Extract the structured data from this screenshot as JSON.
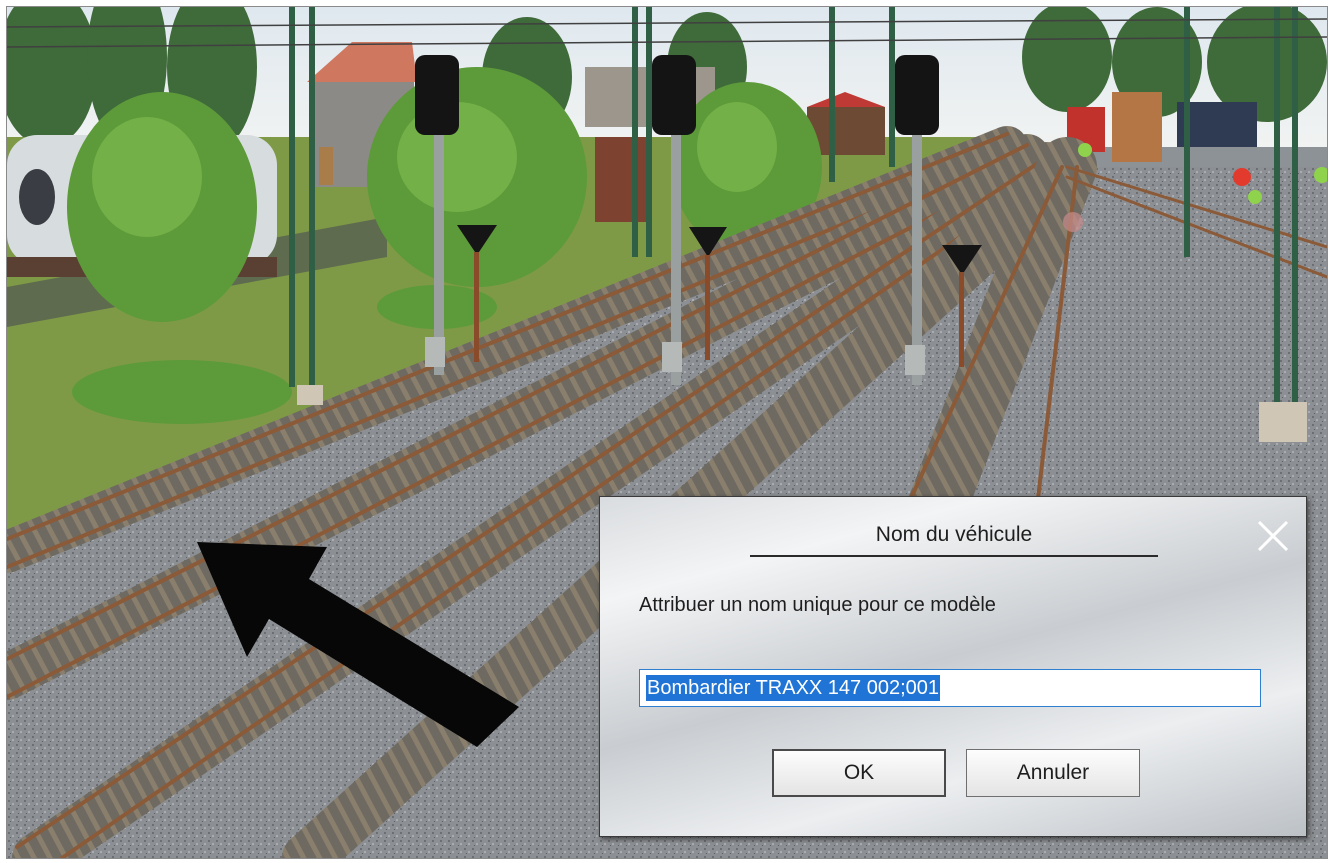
{
  "dialog": {
    "title": "Nom du véhicule",
    "message": "Attribuer un nom unique pour ce modèle",
    "input_value": "Bombardier TRAXX 147 002;001",
    "ok_label": "OK",
    "cancel_label": "Annuler",
    "close_icon": "close-icon"
  },
  "scene": {
    "description_icon": "pointer-arrow-icon",
    "colors": {
      "grass": "#7f9b46",
      "ballast": "#8f9296",
      "rail": "#7a5030",
      "sky": "#e6edf2"
    }
  }
}
